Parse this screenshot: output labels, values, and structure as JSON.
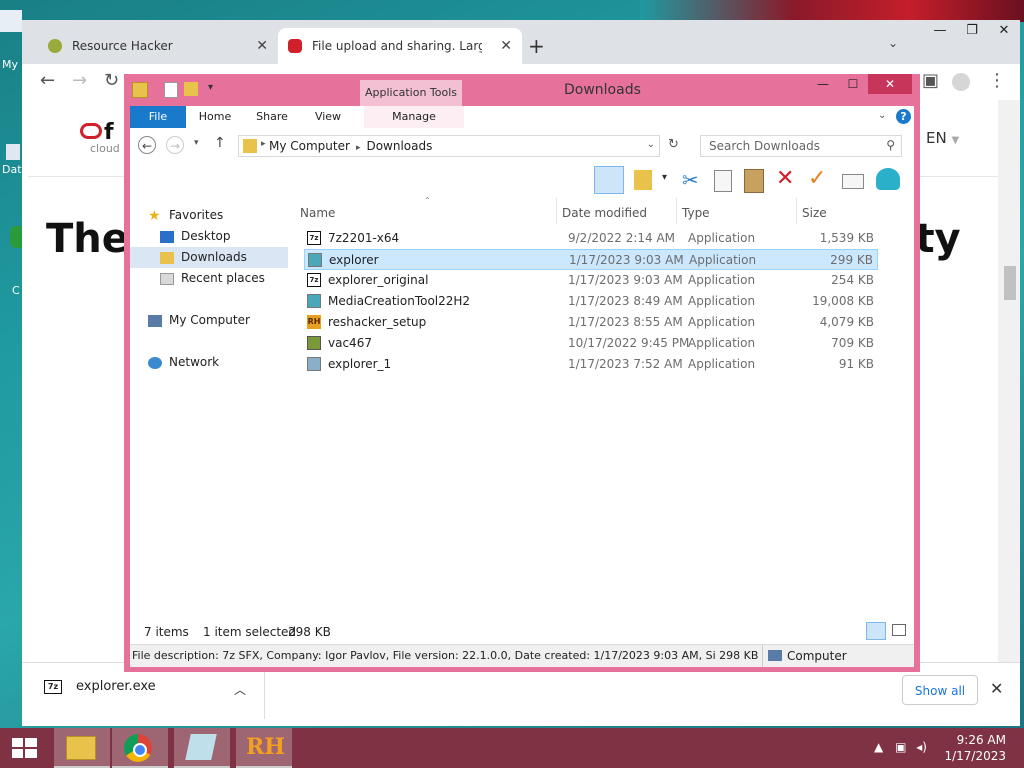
{
  "desktop": {
    "label_top": "My",
    "label_mid": "Dat",
    "label_low": "C"
  },
  "browser": {
    "tabs": [
      {
        "label": "Resource Hacker",
        "close": "✕"
      },
      {
        "label": "File upload and sharing. Large fil",
        "close": "✕"
      }
    ],
    "new_tab": "+",
    "page": {
      "logo_letter": "f",
      "logo_sub": "cloud",
      "lang": "EN",
      "heading_left": "The",
      "heading_right": "rity"
    },
    "download_bar": {
      "file": "explorer.exe",
      "file_icon": "7z",
      "show_all": "Show all"
    }
  },
  "explorer": {
    "title": "Downloads",
    "app_tools": "Application Tools",
    "ribbon_tabs": [
      "File",
      "Home",
      "Share",
      "View",
      "Manage"
    ],
    "address": {
      "root": "My Computer",
      "current": "Downloads"
    },
    "search_placeholder": "Search Downloads",
    "nav": {
      "favorites": "Favorites",
      "desktop": "Desktop",
      "downloads": "Downloads",
      "recent": "Recent places",
      "computer": "My Computer",
      "network": "Network"
    },
    "columns": {
      "name": "Name",
      "date": "Date modified",
      "type": "Type",
      "size": "Size"
    },
    "files": [
      {
        "name": "7z2201-x64",
        "date": "9/2/2022 2:14 AM",
        "type": "Application",
        "size": "1,539 KB",
        "icon": "7z-icon"
      },
      {
        "name": "explorer",
        "date": "1/17/2023 9:03 AM",
        "type": "Application",
        "size": "299 KB",
        "icon": "exe-icon"
      },
      {
        "name": "explorer_original",
        "date": "1/17/2023 9:03 AM",
        "type": "Application",
        "size": "254 KB",
        "icon": "7z-icon"
      },
      {
        "name": "MediaCreationTool22H2",
        "date": "1/17/2023 8:49 AM",
        "type": "Application",
        "size": "19,008 KB",
        "icon": "exe-icon"
      },
      {
        "name": "reshacker_setup",
        "date": "1/17/2023 8:55 AM",
        "type": "Application",
        "size": "4,079 KB",
        "icon": "rh-icon"
      },
      {
        "name": "vac467",
        "date": "10/17/2022 9:45 PM",
        "type": "Application",
        "size": "709 KB",
        "icon": "installer-icon"
      },
      {
        "name": "explorer_1",
        "date": "1/17/2023 7:52 AM",
        "type": "Application",
        "size": "91 KB",
        "icon": "exe-icon"
      }
    ],
    "status": {
      "items": "7 items",
      "selected": "1 item selected",
      "selected_size": "298 KB"
    },
    "details": "File description: 7z SFX, Company: Igor Pavlov, File version: 22.1.0.0, Date created: 1/17/2023 9:03 AM, Si 298 KB",
    "details_location": "Computer"
  },
  "taskbar": {
    "time": "9:26 AM",
    "date": "1/17/2023",
    "rh_label": "RH"
  },
  "colors": {
    "explorer_frame": "#e6729c",
    "taskbar": "#7e3244",
    "selection": "#cce8ff",
    "file_tab": "#1979ca"
  }
}
